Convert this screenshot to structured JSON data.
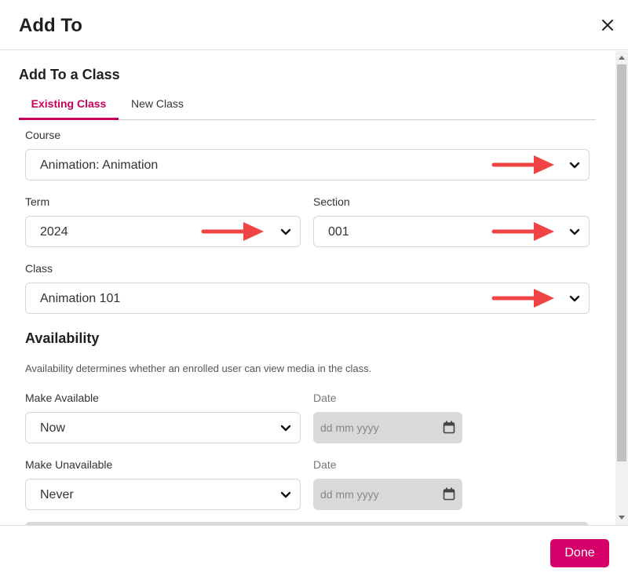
{
  "dialog": {
    "title": "Add To",
    "close_icon": "close-icon"
  },
  "section": {
    "title": "Add To a Class",
    "tabs": [
      {
        "label": "Existing Class",
        "active": true
      },
      {
        "label": "New Class",
        "active": false
      }
    ]
  },
  "fields": {
    "course": {
      "label": "Course",
      "value": "Animation: Animation"
    },
    "term": {
      "label": "Term",
      "value": "2024"
    },
    "section": {
      "label": "Section",
      "value": "001"
    },
    "class": {
      "label": "Class",
      "value": "Animation 101"
    }
  },
  "availability": {
    "title": "Availability",
    "description": "Availability determines whether an enrolled user can view media in the class.",
    "make_available": {
      "label": "Make Available",
      "value": "Now",
      "date_label": "Date",
      "date_placeholder": "dd mm yyyy"
    },
    "make_unavailable": {
      "label": "Make Unavailable",
      "value": "Never",
      "date_label": "Date",
      "date_placeholder": "dd mm yyyy"
    }
  },
  "footer": {
    "done_label": "Done"
  },
  "colors": {
    "accent": "#c6005a",
    "button": "#d6006a",
    "annotation_arrow": "#f04444"
  }
}
